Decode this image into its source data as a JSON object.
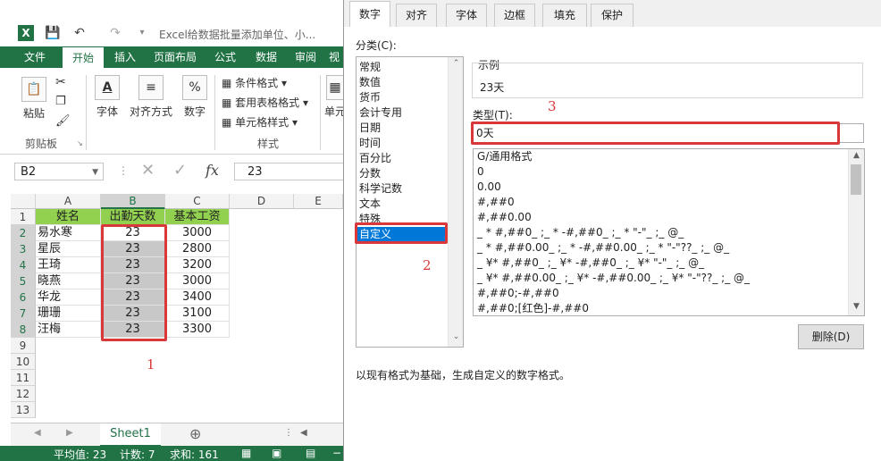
{
  "excel": {
    "window_title": "Excel给数据批量添加单位、小...",
    "ribbon_tabs": [
      "文件",
      "开始",
      "插入",
      "页面布局",
      "公式",
      "数据",
      "审阅",
      "视"
    ],
    "ribbon": {
      "paste": "粘贴",
      "font": "字体",
      "alignment": "对齐方式",
      "number": "数字",
      "conditional_format": "条件格式",
      "table_format": "套用表格格式",
      "cell_style": "单元格样式",
      "cells": "单元",
      "clipboard_group": "剪贴板",
      "style_group": "样式"
    },
    "name_box": "B2",
    "formula_value": "23",
    "columns": [
      "A",
      "B",
      "C",
      "D",
      "E"
    ],
    "rows": [
      "1",
      "2",
      "3",
      "4",
      "5",
      "6",
      "7",
      "8",
      "9",
      "10",
      "11",
      "12",
      "13"
    ],
    "headers": [
      "姓名",
      "出勤天数",
      "基本工资"
    ],
    "data": [
      [
        "易水寒",
        "23",
        "3000"
      ],
      [
        "星辰",
        "23",
        "2800"
      ],
      [
        "王琦",
        "23",
        "3200"
      ],
      [
        "晓燕",
        "23",
        "3000"
      ],
      [
        "华龙",
        "23",
        "3400"
      ],
      [
        "珊珊",
        "23",
        "3100"
      ],
      [
        "汪梅",
        "23",
        "3300"
      ]
    ],
    "sheet_tab": "Sheet1",
    "status": {
      "average": "平均值: 23",
      "count": "计数: 7",
      "sum": "求和: 161"
    }
  },
  "dialog": {
    "tabs": [
      "数字",
      "对齐",
      "字体",
      "边框",
      "填充",
      "保护"
    ],
    "category_label": "分类(C):",
    "categories": [
      "常规",
      "数值",
      "货币",
      "会计专用",
      "日期",
      "时间",
      "百分比",
      "分数",
      "科学记数",
      "文本",
      "特殊",
      "自定义"
    ],
    "selected_category": "自定义",
    "sample_label": "示例",
    "sample_value": "23天",
    "type_label": "类型(T):",
    "type_value": "0天",
    "formats": [
      "G/通用格式",
      "0",
      "0.00",
      "#,##0",
      "#,##0.00",
      "_ * #,##0_ ;_ * -#,##0_ ;_ * \"-\"_ ;_ @_",
      "_ * #,##0.00_ ;_ * -#,##0.00_ ;_ * \"-\"??_ ;_ @_",
      "_ ¥* #,##0_ ;_ ¥* -#,##0_ ;_ ¥* \"-\"_ ;_ @_",
      "_ ¥* #,##0.00_ ;_ ¥* -#,##0.00_ ;_ ¥* \"-\"??_ ;_ @_",
      "#,##0;-#,##0",
      "#,##0;[红色]-#,##0"
    ],
    "delete_button": "删除(D)",
    "description": "以现有格式为基础，生成自定义的数字格式。"
  },
  "annotations": [
    "1",
    "2",
    "3"
  ],
  "colors": {
    "excel_green": "#217346",
    "header_fill": "#92d050",
    "annotation_red": "#d9383a",
    "selection_blue": "#0078d7"
  }
}
